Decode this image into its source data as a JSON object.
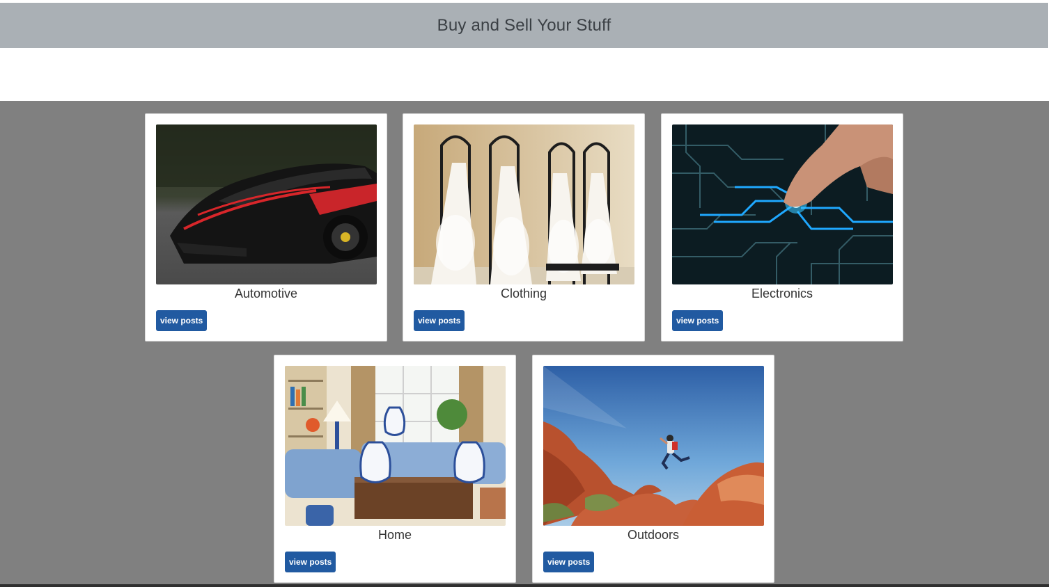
{
  "header": {
    "title": "Buy and Sell Your Stuff"
  },
  "categories": [
    {
      "label": "Automotive",
      "button": "view posts",
      "image": "sports-car-photo"
    },
    {
      "label": "Clothing",
      "button": "view posts",
      "image": "wedding-dresses-photo"
    },
    {
      "label": "Electronics",
      "button": "view posts",
      "image": "circuit-board-photo"
    },
    {
      "label": "Home",
      "button": "view posts",
      "image": "living-room-photo"
    },
    {
      "label": "Outdoors",
      "button": "view posts",
      "image": "hiker-canyon-photo"
    }
  ],
  "colors": {
    "header_bg": "#aab0b5",
    "main_bg": "#808080",
    "button_bg": "#215aa1"
  }
}
